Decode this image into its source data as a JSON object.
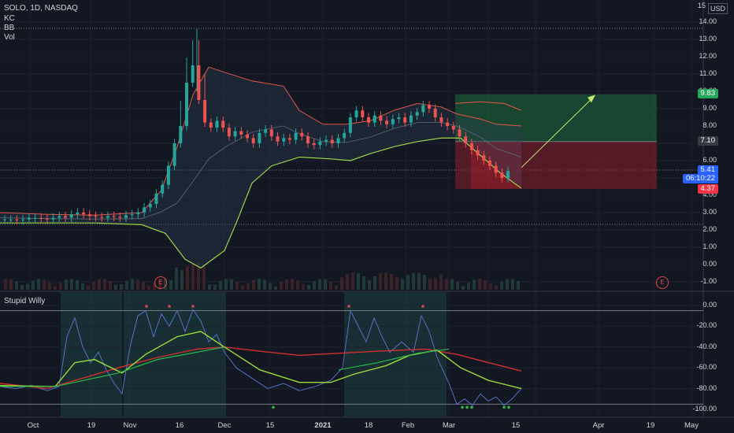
{
  "header": {
    "symbol_line": "SOLO, 1D, NASDAQ",
    "indicators": [
      "KC",
      "BB",
      "Vol"
    ],
    "currency": "USD"
  },
  "price_scale": {
    "labels": [
      "14.00",
      "13.00",
      "12.00",
      "11.00",
      "10.00",
      "9.00",
      "8.00",
      "7.00",
      "6.00",
      "5.00",
      "4.00",
      "3.00",
      "2.00",
      "1.00",
      "0.00",
      "-1.00"
    ],
    "top_partial": "15"
  },
  "badges": {
    "target": {
      "label": "9.83",
      "color": "#26a65b"
    },
    "entry": {
      "label": "7.10",
      "color": "#363a45"
    },
    "last": {
      "label": "5.41",
      "color": "#2962ff"
    },
    "countdown": {
      "label": "06:10:22",
      "color": "#2962ff"
    },
    "stop": {
      "label": "4.37",
      "color": "#f23645"
    }
  },
  "earnings_markers": [
    "E",
    "E"
  ],
  "lower_pane": {
    "title": "Stupid Willy",
    "labels": [
      "0.00",
      "-20.00",
      "-40.00",
      "-60.00",
      "-80.00",
      "-100.00"
    ]
  },
  "time_axis": {
    "labels": [
      {
        "text": "Oct",
        "bold": false
      },
      {
        "text": "19",
        "bold": false
      },
      {
        "text": "Nov",
        "bold": false
      },
      {
        "text": "16",
        "bold": false
      },
      {
        "text": "Dec",
        "bold": false
      },
      {
        "text": "15",
        "bold": false
      },
      {
        "text": "2021",
        "bold": true
      },
      {
        "text": "18",
        "bold": false
      },
      {
        "text": "Feb",
        "bold": false
      },
      {
        "text": "Mar",
        "bold": false
      },
      {
        "text": "15",
        "bold": false
      },
      {
        "text": "Apr",
        "bold": false
      },
      {
        "text": "19",
        "bold": false
      },
      {
        "text": "May",
        "bold": false
      }
    ]
  },
  "colors": {
    "background": "#131722",
    "up": "#26a69a",
    "down": "#ef5350",
    "keltner_upper": "#e0584a",
    "keltner_lower": "#9bd44a",
    "profit_zone": "#1e6b3a",
    "loss_zone": "#8a1f2a",
    "willy_fast": "#5470c6",
    "willy_green": "#9bdb3a",
    "willy_red": "#d03030"
  }
}
